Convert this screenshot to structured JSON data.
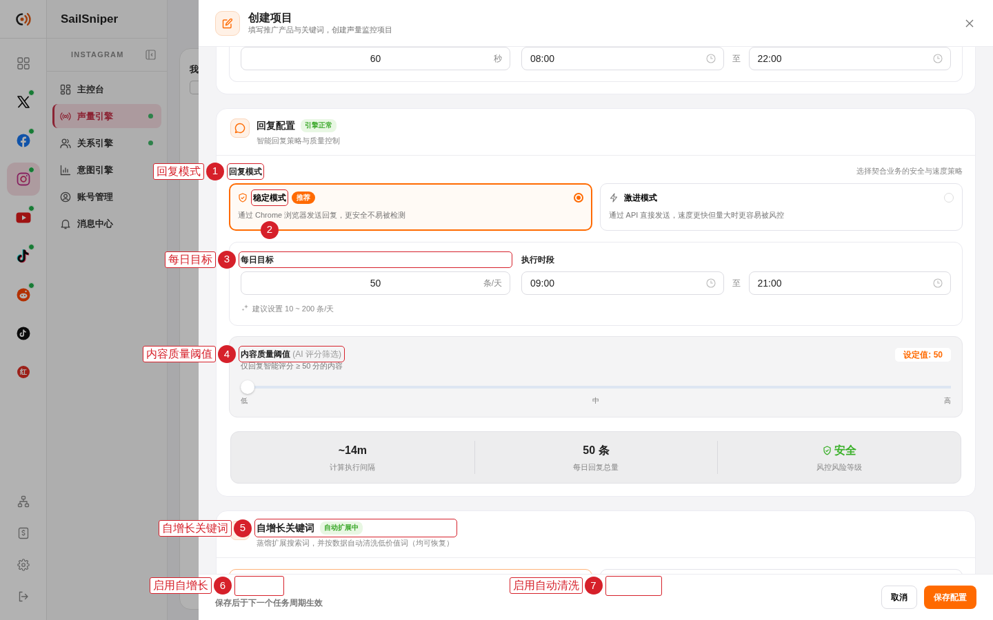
{
  "app": {
    "brand": "SailSniper",
    "platform_label": "INSTAGRAM",
    "rail": [
      {
        "kind": "overview",
        "selected": false,
        "online": false
      },
      {
        "kind": "x",
        "selected": false,
        "online": true
      },
      {
        "kind": "facebook",
        "selected": false,
        "online": true
      },
      {
        "kind": "instagram",
        "selected": true,
        "online": true
      },
      {
        "kind": "youtube",
        "selected": false,
        "online": true
      },
      {
        "kind": "tiktok",
        "selected": false,
        "online": true
      },
      {
        "kind": "reddit",
        "selected": false,
        "online": true
      },
      {
        "kind": "tiktok-dark",
        "selected": false,
        "online": false
      },
      {
        "kind": "xiaohongshu",
        "text": "红",
        "selected": false,
        "online": false
      }
    ],
    "rail_bottom": [
      {
        "kind": "sitemap"
      },
      {
        "kind": "billing"
      },
      {
        "kind": "settings"
      },
      {
        "kind": "logout"
      }
    ],
    "nav": [
      {
        "kind": "dashboard",
        "label": "主控台",
        "selected": false,
        "online": false
      },
      {
        "kind": "broadcast",
        "label": "声量引擎",
        "selected": true,
        "online": true
      },
      {
        "kind": "users",
        "label": "关系引擎",
        "selected": false,
        "online": true
      },
      {
        "kind": "chart",
        "label": "意图引擎",
        "selected": false,
        "online": false
      },
      {
        "kind": "account",
        "label": "账号管理",
        "selected": false,
        "online": false
      },
      {
        "kind": "bell",
        "label": "消息中心",
        "selected": false,
        "online": false
      }
    ],
    "content_peek": {
      "heading": "我"
    }
  },
  "drawer": {
    "title": "创建项目",
    "subtitle": "填写推广产品与关键词，创建声量监控项目",
    "schedule_row": {
      "interval": {
        "value": "60",
        "unit": "秒"
      },
      "start": "08:00",
      "to": "至",
      "end": "22:00"
    },
    "reply": {
      "title": "回复配置",
      "badge": "引擎正常",
      "subtitle": "智能回复策略与质量控制",
      "mode_label": {
        "text": "回复模式",
        "callout": {
          "kind": "labeled",
          "number": "1",
          "label": "回复模式"
        }
      },
      "mode_hint": "选择契合业务的安全与速度策略",
      "modes": [
        {
          "kind": "stable",
          "title": "稳定模式",
          "callout": {
            "kind": "number-below",
            "number": "2"
          },
          "badge": "推荐",
          "description": "通过 Chrome 浏览器发送回复，更安全不易被检测",
          "selected": true
        },
        {
          "kind": "aggressive",
          "title": "激进模式",
          "description": "通过 API 直接发送，速度更快但量大时更容易被风控",
          "selected": false
        }
      ],
      "daily_target": {
        "label": "每日目标",
        "callout": {
          "kind": "labeled",
          "number": "3",
          "label": "每日目标"
        },
        "value": "50",
        "unit": "条/天",
        "hint": "建议设置 10 ~ 200 条/天"
      },
      "window": {
        "label": "执行时段",
        "start": "09:00",
        "to": "至",
        "end": "21:00"
      },
      "quality": {
        "label": "内容质量阈值",
        "label_suffix": "(AI 评分筛选)",
        "callout": {
          "kind": "labeled",
          "number": "4",
          "label": "内容质量阈值"
        },
        "subtitle": "仅回复智能评分 ≥ 50 分的内容",
        "value_badge": "设定值: 50",
        "level": 0,
        "ticks": [
          "低",
          "中",
          "高"
        ]
      },
      "stats": [
        {
          "kind": "plain",
          "value": "~14m",
          "label": "计算执行间隔"
        },
        {
          "kind": "plain",
          "value": "50 条",
          "label": "每日回复总量"
        },
        {
          "kind": "safe",
          "value": "安全",
          "label": "风控风险等级"
        }
      ]
    },
    "growth": {
      "title": "自增长关键词",
      "badge": "自动扩展中",
      "callout": {
        "kind": "labeled",
        "number": "5",
        "label": "自增长关键词"
      },
      "subtitle": "蒸馏扩展搜索词，并按数据自动清洗低价值词（均可恢复）",
      "options": [
        {
          "selected": true
        },
        {
          "selected": false
        }
      ],
      "option_callouts": [
        {
          "kind": "labeled",
          "number": "6",
          "label": "启用自增长"
        },
        {
          "kind": "labeled",
          "number": "7",
          "label": "启用自动清洗"
        }
      ]
    },
    "footer": {
      "note": "保存后于下一个任务周期生效",
      "buttons": [
        {
          "kind": "secondary",
          "label": "取消"
        },
        {
          "kind": "primary",
          "label": "保存配置"
        }
      ]
    }
  }
}
